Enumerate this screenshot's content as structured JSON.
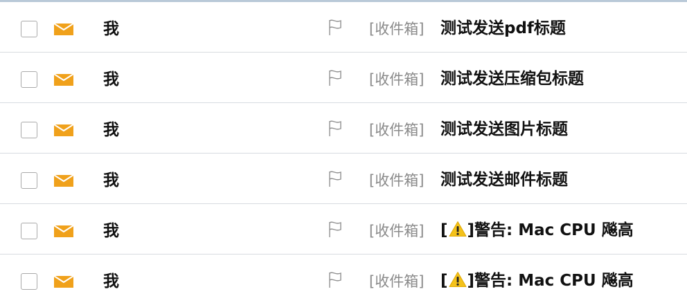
{
  "colors": {
    "envelope": "#f0a11b",
    "warning_triangle": "#f4c21b",
    "divider": "#d7dbe0",
    "folder_text": "#8a8a8a"
  },
  "mail_rows": [
    {
      "sender": "我",
      "folder": "[收件箱]",
      "subject": "测试发送pdf标题"
    },
    {
      "sender": "我",
      "folder": "[收件箱]",
      "subject": "测试发送压缩包标题"
    },
    {
      "sender": "我",
      "folder": "[收件箱]",
      "subject": "测试发送图片标题"
    },
    {
      "sender": "我",
      "folder": "[收件箱]",
      "subject": "测试发送邮件标题"
    },
    {
      "sender": "我",
      "folder": "[收件箱]",
      "subject_prefix": "[",
      "subject_icon": "warning-icon",
      "subject_rest": "]警告: Mac CPU 飚高"
    },
    {
      "sender": "我",
      "folder": "[收件箱]",
      "subject_prefix": "[",
      "subject_icon": "warning-icon",
      "subject_rest": "]警告: Mac CPU 飚高"
    }
  ]
}
